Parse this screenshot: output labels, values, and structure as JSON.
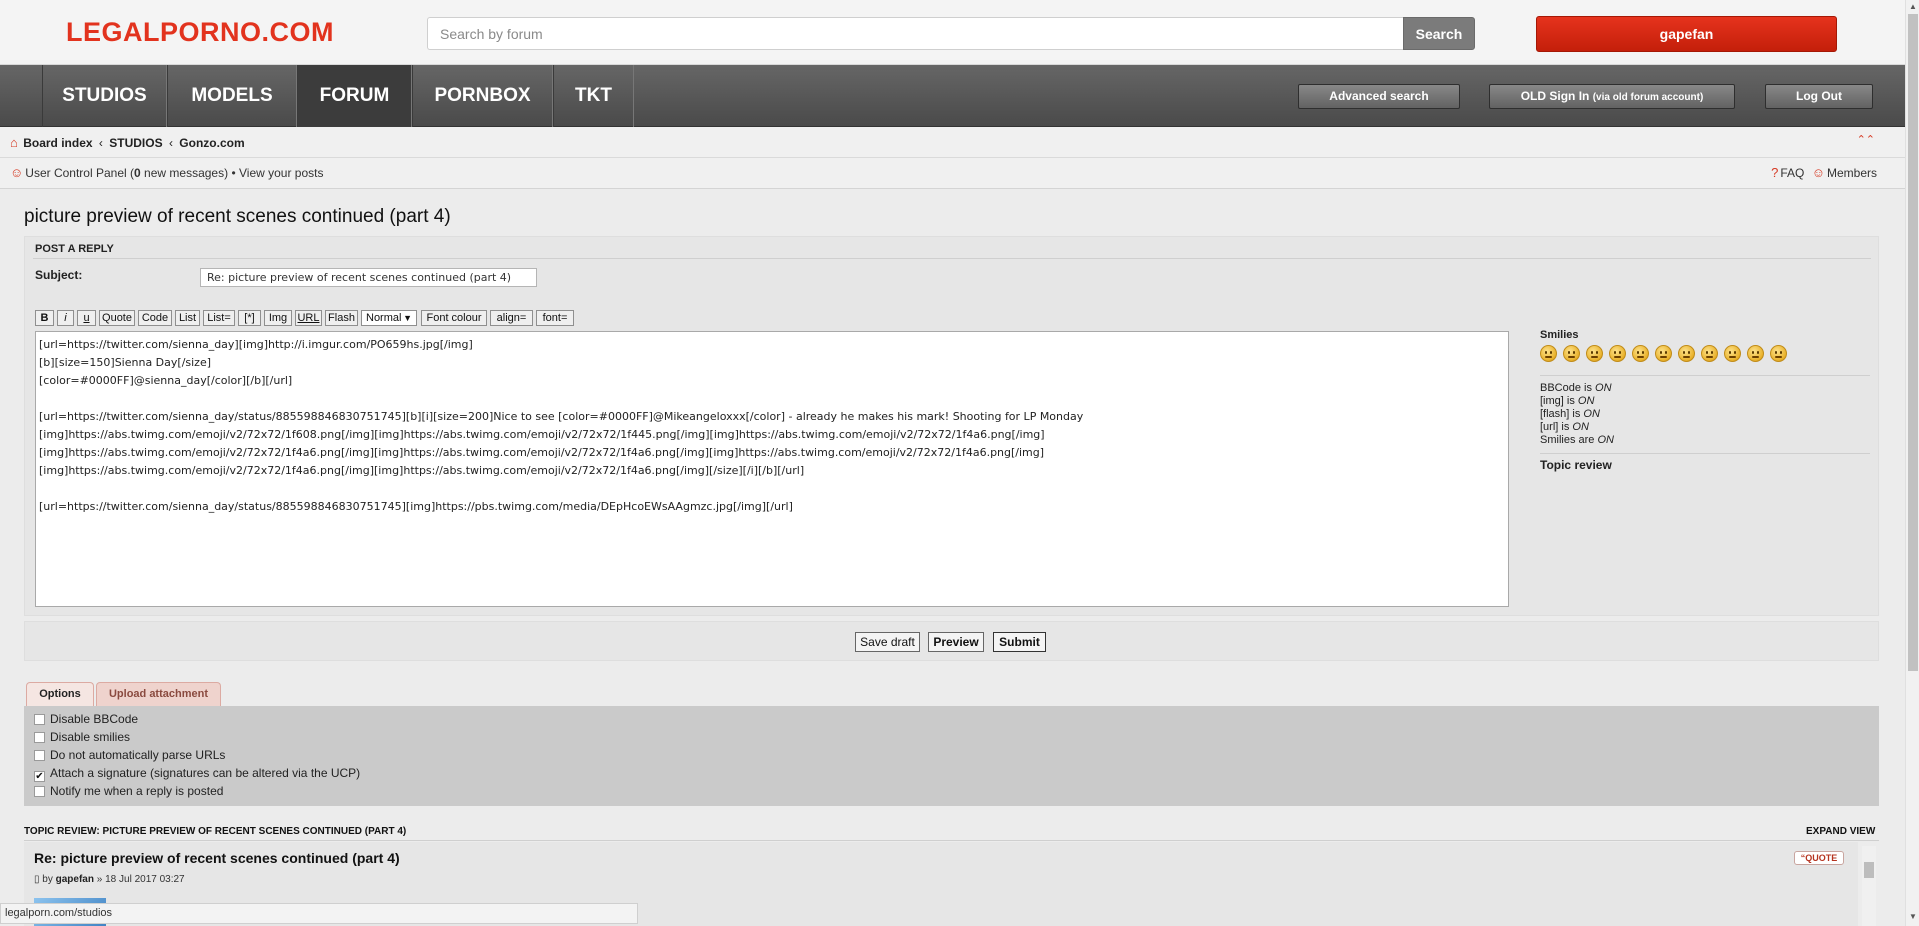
{
  "header": {
    "logo": "LEGALPORNO.COM",
    "search_placeholder": "Search by forum",
    "search_button": "Search",
    "user_button": "gapefan"
  },
  "nav": {
    "items": [
      "STUDIOS",
      "MODELS",
      "FORUM",
      "PORNBOX",
      "TKT"
    ],
    "active": "FORUM",
    "advanced_search": "Advanced search",
    "old_sign_in": "OLD Sign In",
    "old_sign_in_sub": "(via old forum account)",
    "logout": "Log Out"
  },
  "breadcrumb": {
    "items": [
      "Board index",
      "STUDIOS",
      "Gonzo.com"
    ],
    "separator": "‹",
    "ucp": "User Control Panel",
    "new_messages_count": "0",
    "new_messages_suffix": "new messages",
    "bullet": "•",
    "view_posts": "View your posts",
    "faq": "FAQ",
    "members": "Members",
    "collapse_glyph": "⌃⌃"
  },
  "page": {
    "title": "picture preview of recent scenes continued (part 4)"
  },
  "post_form": {
    "heading": "POST A REPLY",
    "subject_label": "Subject:",
    "subject_value": "Re: picture preview of recent scenes continued (part 4)",
    "toolbar": [
      "B",
      "i",
      "u",
      "Quote",
      "Code",
      "List",
      "List=",
      "[*]",
      "Img",
      "URL",
      "Flash",
      "Normal",
      "Font colour",
      "align=",
      "font="
    ],
    "editor_text": "[url=https://twitter.com/sienna_day][img]http://i.imgur.com/PO659hs.jpg[/img]\n[b][size=150]Sienna Day[/size]\n[color=#0000FF]@sienna_day[/color][/b][/url]\n\n[url=https://twitter.com/sienna_day/status/885598846830751745][b][i][size=200]Nice to see [color=#0000FF]@Mikeangeloxxx[/color] - already he makes his mark! Shooting for LP Monday\n[img]https://abs.twimg.com/emoji/v2/72x72/1f608.png[/img][img]https://abs.twimg.com/emoji/v2/72x72/1f445.png[/img][img]https://abs.twimg.com/emoji/v2/72x72/1f4a6.png[/img]\n[img]https://abs.twimg.com/emoji/v2/72x72/1f4a6.png[/img][img]https://abs.twimg.com/emoji/v2/72x72/1f4a6.png[/img][img]https://abs.twimg.com/emoji/v2/72x72/1f4a6.png[/img]\n[img]https://abs.twimg.com/emoji/v2/72x72/1f4a6.png[/img][img]https://abs.twimg.com/emoji/v2/72x72/1f4a6.png[/img][/size][/i][/b][/url]\n\n[url=https://twitter.com/sienna_day/status/885598846830751745][img]https://pbs.twimg.com/media/DEpHcoEWsAAgmzc.jpg[/img][/url]"
  },
  "sidebar": {
    "smilies_title": "Smilies",
    "smiley_count": 11,
    "status": [
      {
        "label": "BBCode is",
        "value": "ON"
      },
      {
        "label": "[img] is",
        "value": "ON"
      },
      {
        "label": "[flash] is",
        "value": "ON"
      },
      {
        "label": "[url] is",
        "value": "ON"
      },
      {
        "label": "Smilies are",
        "value": "ON"
      }
    ],
    "topic_review": "Topic review"
  },
  "actions": {
    "save_draft": "Save draft",
    "preview": "Preview",
    "submit": "Submit"
  },
  "tabs": {
    "options": "Options",
    "upload": "Upload attachment"
  },
  "options": [
    {
      "label": "Disable BBCode",
      "checked": false
    },
    {
      "label": "Disable smilies",
      "checked": false
    },
    {
      "label": "Do not automatically parse URLs",
      "checked": false
    },
    {
      "label": "Attach a signature (signatures can be altered via the UCP)",
      "checked": true
    },
    {
      "label": "Notify me when a reply is posted",
      "checked": false
    }
  ],
  "topic_review": {
    "heading": "TOPIC REVIEW: PICTURE PREVIEW OF RECENT SCENES CONTINUED (PART 4)",
    "expand": "EXPAND VIEW",
    "post_title": "Re: picture preview of recent scenes continued (part 4)",
    "by": "by",
    "author": "gapefan",
    "date": "» 18 Jul 2017 03:27",
    "quote": "QUOTE"
  },
  "statusbar": {
    "url": "legalporn.com/studios"
  },
  "colors": {
    "brand_red": "#e2331e",
    "nav_dark": "#4a4a4a"
  }
}
